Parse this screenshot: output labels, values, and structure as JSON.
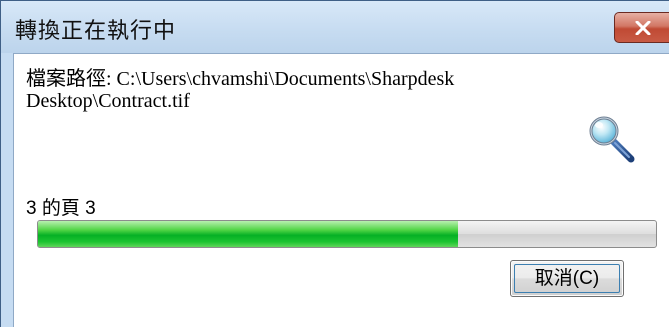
{
  "window": {
    "title": "轉換正在執行中",
    "close_icon": "close-x-icon",
    "colors": {
      "title_bar": "#c7dcf1",
      "close_button": "#c85a44",
      "progress_fill": "#06b025"
    }
  },
  "file": {
    "path_text": "檔案路徑: C:\\Users\\chvamshi\\Documents\\Sharpdesk\nDesktop\\Contract.tif"
  },
  "status": {
    "icon": "magnifier-icon",
    "page_text": "3 的頁 3"
  },
  "progress": {
    "percent": 68
  },
  "buttons": {
    "cancel_label": "取消(C)"
  }
}
